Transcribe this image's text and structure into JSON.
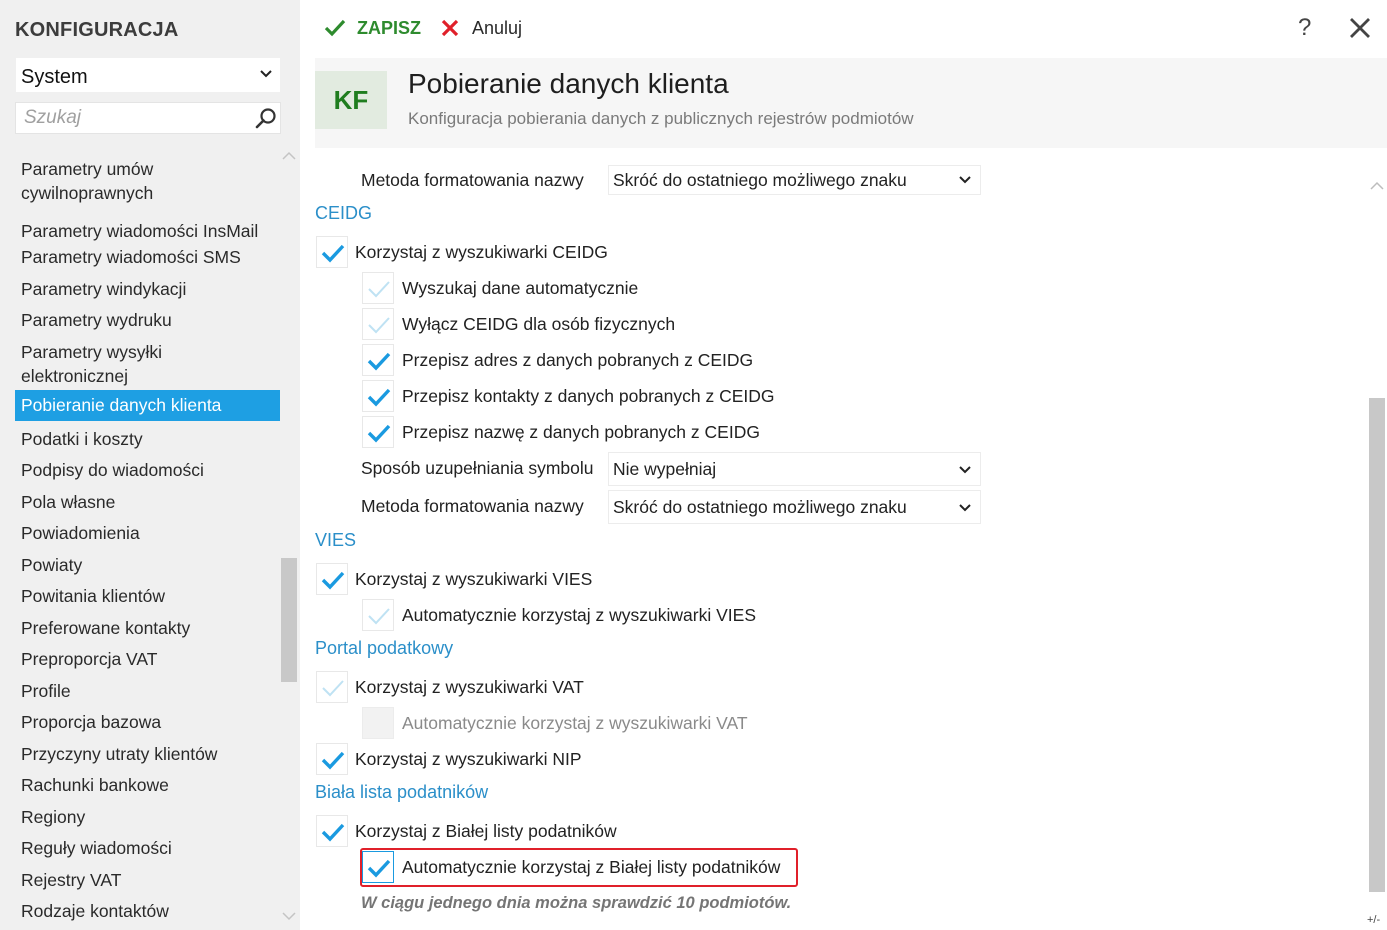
{
  "app": {
    "title": "KONFIGURACJA"
  },
  "sidebar": {
    "module_select": "System",
    "search_placeholder": "Szukaj",
    "items": [
      {
        "label": "Parametry umów cywilnoprawnych"
      },
      {
        "label": "Parametry wiadomości InsMail"
      },
      {
        "label": "Parametry wiadomości SMS"
      },
      {
        "label": "Parametry windykacji"
      },
      {
        "label": "Parametry wydruku"
      },
      {
        "label": "Parametry wysyłki elektronicznej"
      },
      {
        "label": "Pobieranie danych klienta",
        "active": true
      },
      {
        "label": "Podatki i koszty"
      },
      {
        "label": "Podpisy do wiadomości"
      },
      {
        "label": "Pola własne"
      },
      {
        "label": "Powiadomienia"
      },
      {
        "label": "Powiaty"
      },
      {
        "label": "Powitania klientów"
      },
      {
        "label": "Preferowane kontakty"
      },
      {
        "label": "Preproporcja VAT"
      },
      {
        "label": "Profile"
      },
      {
        "label": "Proporcja bazowa"
      },
      {
        "label": "Przyczyny utraty klientów"
      },
      {
        "label": "Rachunki bankowe"
      },
      {
        "label": "Regiony"
      },
      {
        "label": "Reguły wiadomości"
      },
      {
        "label": "Rejestry VAT"
      },
      {
        "label": "Rodzaje kontaktów"
      }
    ]
  },
  "toolbar": {
    "save_label": "ZAPISZ",
    "cancel_label": "Anuluj",
    "help_label": "?"
  },
  "header": {
    "badge": "KF",
    "title": "Pobieranie danych klienta",
    "subtitle": "Konfiguracja pobierania danych z publicznych rejestrów podmiotów"
  },
  "content": {
    "top_name_format": {
      "label": "Metoda formatowania nazwy",
      "value": "Skróć do ostatniego możliwego znaku"
    },
    "ceidg": {
      "heading": "CEIDG",
      "use": {
        "label": "Korzystaj z wyszukiwarki CEIDG",
        "checked": true
      },
      "auto_search": {
        "label": "Wyszukaj dane automatycznie",
        "checked": false
      },
      "disable_persons": {
        "label": "Wyłącz CEIDG dla osób fizycznych",
        "checked": false
      },
      "copy_address": {
        "label": "Przepisz adres z danych pobranych z CEIDG",
        "checked": true
      },
      "copy_contacts": {
        "label": "Przepisz kontakty z danych pobranych z CEIDG",
        "checked": true
      },
      "copy_name": {
        "label": "Przepisz nazwę z danych pobranych z CEIDG",
        "checked": true
      },
      "symbol_fill": {
        "label": "Sposób uzupełniania symbolu",
        "value": "Nie wypełniaj"
      },
      "name_format": {
        "label": "Metoda formatowania nazwy",
        "value": "Skróć do ostatniego możliwego znaku"
      }
    },
    "vies": {
      "heading": "VIES",
      "use": {
        "label": "Korzystaj z wyszukiwarki VIES",
        "checked": true
      },
      "auto_use": {
        "label": "Automatycznie korzystaj z wyszukiwarki VIES",
        "checked": false
      }
    },
    "portal": {
      "heading": "Portal podatkowy",
      "use_vat": {
        "label": "Korzystaj z wyszukiwarki VAT",
        "checked": false
      },
      "auto_vat": {
        "label": "Automatycznie korzystaj z wyszukiwarki VAT",
        "checked": false,
        "disabled": true
      },
      "use_nip": {
        "label": "Korzystaj z wyszukiwarki NIP",
        "checked": true
      }
    },
    "whitelist": {
      "heading": "Biała lista podatników",
      "use": {
        "label": "Korzystaj z Białej listy podatników",
        "checked": true
      },
      "auto_use": {
        "label": "Automatycznie korzystaj z Białej listy podatników",
        "checked": true
      },
      "note": "W ciągu jednego dnia można sprawdzić 10 podmiotów."
    },
    "zoom_label": "+/-"
  },
  "colors": {
    "accent": "#1e9fe3",
    "section_heading": "#2b8fc9",
    "save_green": "#2e8b2e",
    "cancel_red": "#e0202a",
    "highlight_red": "#e0202a"
  }
}
